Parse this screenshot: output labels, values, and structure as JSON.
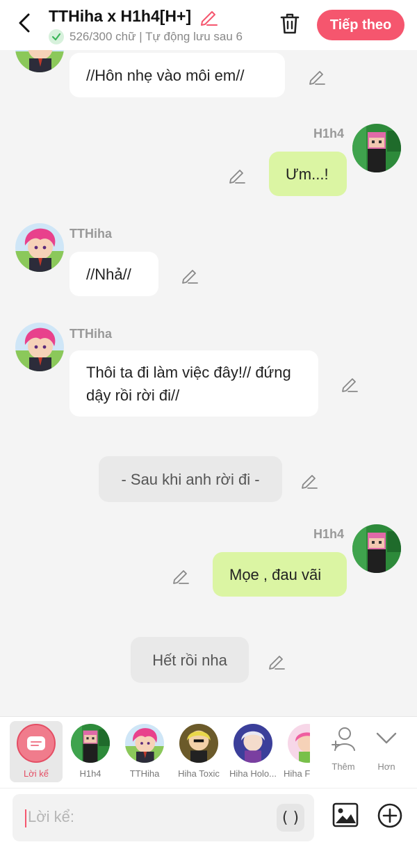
{
  "header": {
    "title": "TTHiha x H1h4[H+]",
    "subtitle": "526/300 chữ | Tự động lưu sau 6",
    "next_label": "Tiếp theo"
  },
  "colors": {
    "accent": "#f5566e",
    "self_bubble": "#dbf5a3",
    "narration_bubble": "#e9e9e9"
  },
  "messages": [
    {
      "type": "other",
      "speaker": "TTHiha",
      "text": "//Hôn nhẹ vào môi em//"
    },
    {
      "type": "self",
      "speaker": "H1h4",
      "text": "Ưm...!"
    },
    {
      "type": "other",
      "speaker": "TTHiha",
      "text": "//Nhả//"
    },
    {
      "type": "other",
      "speaker": "TTHiha",
      "text": "Thôi ta đi làm việc đây!// đứng dậy rồi rời đi//"
    },
    {
      "type": "narration",
      "text": "- Sau khi anh rời đi -"
    },
    {
      "type": "self",
      "speaker": "H1h4",
      "text": "Mọe , đau vãi"
    },
    {
      "type": "narration",
      "text": "Hết rồi nha"
    }
  ],
  "characters": {
    "narrator": "Lời kể",
    "list": [
      "H1h4",
      "TTHiha",
      "Hiha Toxic",
      "Hiha Holo...",
      "Hiha F"
    ],
    "add_label": "Thêm",
    "more_label": "Hơn"
  },
  "composer": {
    "placeholder": "Lời kể:",
    "paren": "( )"
  }
}
